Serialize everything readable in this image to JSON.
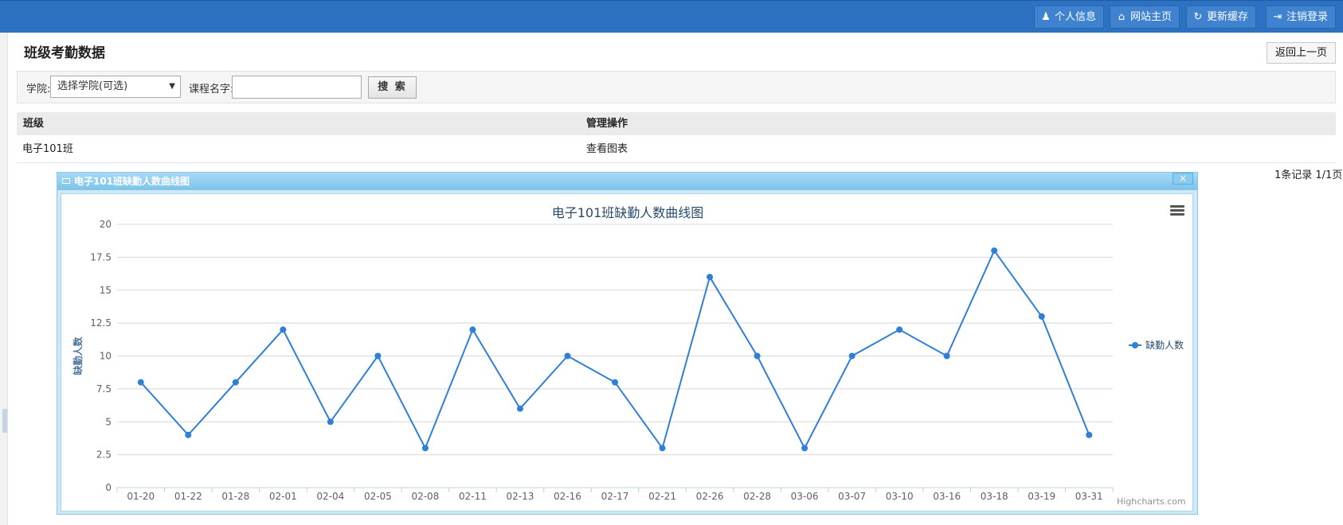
{
  "topbar": {
    "buttons": [
      {
        "label": "个人信息",
        "icon": "user-icon"
      },
      {
        "label": "网站主页",
        "icon": "home-icon"
      },
      {
        "label": "更新缓存",
        "icon": "refresh-icon"
      },
      {
        "label": "注销登录",
        "icon": "logout-icon"
      }
    ]
  },
  "page": {
    "title": "班级考勤数据",
    "back_label": "返回上一页"
  },
  "search": {
    "college_label": "学院:",
    "college_selected": "选择学院(可选)",
    "course_label": "课程名字:",
    "course_value": "",
    "button_label": "搜 索"
  },
  "table": {
    "headers": [
      "班级",
      "管理操作"
    ],
    "rows": [
      {
        "class": "电子101班",
        "action": "查看图表"
      }
    ]
  },
  "pager": {
    "text": "1条记录 1/1页"
  },
  "dialog": {
    "title": "电子101班缺勤人数曲线图",
    "close": "×"
  },
  "chart_data": {
    "type": "line",
    "title": "电子101班缺勤人数曲线图",
    "ylabel": "缺勤人数",
    "xlabel": "",
    "categories": [
      "01-20",
      "01-22",
      "01-28",
      "02-01",
      "02-04",
      "02-05",
      "02-08",
      "02-11",
      "02-13",
      "02-16",
      "02-17",
      "02-21",
      "02-26",
      "02-28",
      "03-06",
      "03-07",
      "03-10",
      "03-16",
      "03-18",
      "03-19",
      "03-31"
    ],
    "series": [
      {
        "name": "缺勤人数",
        "color": "#2f7ed8",
        "values": [
          8,
          4,
          8,
          12,
          5,
          10,
          3,
          12,
          6,
          10,
          8,
          3,
          16,
          10,
          3,
          10,
          12,
          10,
          18,
          13,
          4
        ]
      }
    ],
    "ylim": [
      0,
      20
    ],
    "yticks": [
      "0",
      "2.5",
      "5",
      "7.5",
      "10",
      "12.5",
      "15",
      "17.5",
      "20"
    ],
    "grid": true,
    "legend": "right",
    "credit": "Highcharts.com"
  }
}
